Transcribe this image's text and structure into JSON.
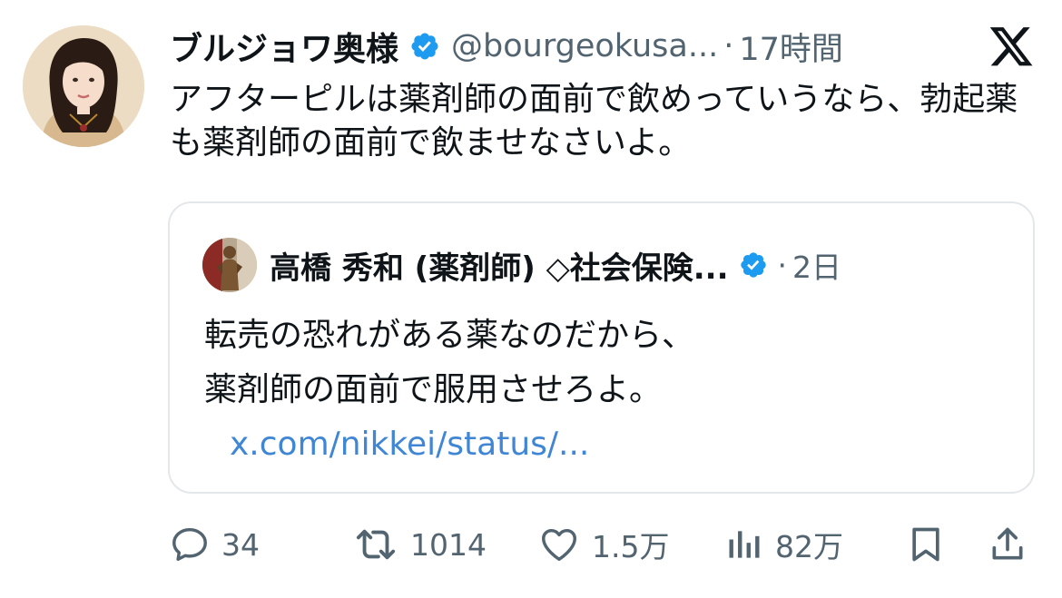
{
  "author": {
    "display_name": "ブルジョワ奥様",
    "handle": "@bourgeokusa...",
    "separator": "·",
    "time": "17時間",
    "avatar_icon": "woman-portrait-avatar",
    "verified_icon": "verified-badge-icon"
  },
  "platform": {
    "logo_icon": "x-logo-icon"
  },
  "tweet": {
    "text": "アフターピルは薬剤師の面前で飲めっていうなら、勃起薬も薬剤師の面前で飲ませなさいよ。"
  },
  "quoted": {
    "display_name": "高橋 秀和 (薬剤師) ◇社会保険...",
    "separator": "·",
    "time": "2日",
    "line1": "転売の恐れがある薬なのだから、",
    "line2": "薬剤師の面前で服用させろよ。",
    "link_text": "x.com/nikkei/status/..."
  },
  "actions": {
    "reply_count": "34",
    "retweet_count": "1014",
    "like_count": "1.5万",
    "views_count": "82万"
  },
  "colors": {
    "verified_blue": "#1d9bf0",
    "link_blue": "#3f86d4",
    "secondary_text": "#536471",
    "border": "#e3e7ea"
  }
}
